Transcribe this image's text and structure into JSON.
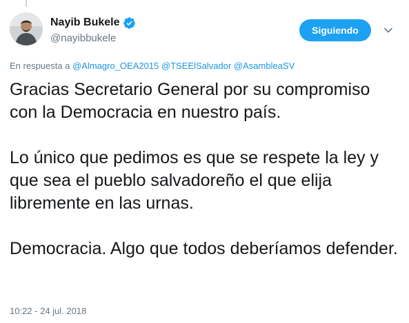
{
  "author": {
    "display_name": "Nayib Bukele",
    "handle": "@nayibbukele",
    "verified_icon": "verified-badge-icon",
    "avatar_icon": "profile-photo"
  },
  "follow_button": {
    "label": "Siguiendo"
  },
  "menu": {
    "icon": "chevron-down-icon"
  },
  "reply_context": {
    "prefix": "En respuesta a",
    "mentions": [
      "@Almagro_OEA2015",
      "@TSEElSalvador",
      "@AsambleaSV"
    ]
  },
  "tweet": {
    "paragraphs": [
      "Gracias Secretario General por su compromiso con la Democracia en nuestro país.",
      "Lo único que pedimos es que se respete la ley y que sea el pueblo salvadoreño el que elija libremente en las urnas.",
      "Democracia. Algo que todos deberíamos defender."
    ],
    "timestamp": "10:22 - 24 jul. 2018"
  },
  "colors": {
    "accent": "#1da1f2",
    "link": "#1b95e0",
    "muted": "#657786",
    "text": "#14171a"
  }
}
